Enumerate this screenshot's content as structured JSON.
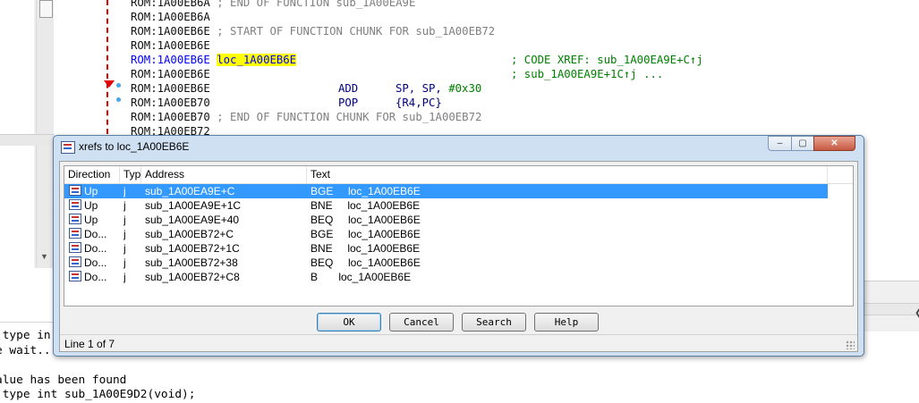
{
  "disassembly": {
    "lines": [
      {
        "addr": "ROM:1A00EB6A",
        "text": " ; END OF FUNCTION sub_1A00EA9E",
        "kind": "comment"
      },
      {
        "addr": "ROM:1A00EB6A",
        "text": "",
        "kind": "plain"
      },
      {
        "addr": "ROM:1A00EB6E",
        "text": " ; START OF FUNCTION CHUNK FOR sub_1A00EB72",
        "kind": "comment"
      },
      {
        "addr": "ROM:1A00EB6E",
        "text": "",
        "kind": "plain"
      },
      {
        "addr": "ROM:1A00EB6E",
        "label": "loc_1A00EB6E",
        "xref": "; CODE XREF: sub_1A00EA9E+C↑j",
        "kind": "label"
      },
      {
        "addr": "ROM:1A00EB6E",
        "xref": "; sub_1A00EA9E+1C↑j ...",
        "kind": "xref"
      },
      {
        "addr": "ROM:1A00EB6E",
        "mnem": "ADD",
        "ops": "SP, SP, ",
        "imm": "#0x30",
        "kind": "insn"
      },
      {
        "addr": "ROM:1A00EB70",
        "mnem": "POP",
        "ops": "{R4,PC}",
        "kind": "insn"
      },
      {
        "addr": "ROM:1A00EB70",
        "text": " ; END OF FUNCTION CHUNK FOR sub_1A00EB72",
        "kind": "comment"
      },
      {
        "addr": "ROM:1A00EB72",
        "text": "",
        "kind": "plain"
      }
    ]
  },
  "output": {
    "lines": [
      " type in",
      "e wait..",
      "",
      "alue has been found",
      " type int sub_1A00E9D2(void);"
    ]
  },
  "dialog": {
    "title": "xrefs to loc_1A00EB6E",
    "caption_buttons": {
      "minimize": "–",
      "maximize": "▢",
      "close": "✕"
    },
    "columns": [
      "Direction",
      "Typ",
      "Address",
      "Text"
    ],
    "rows": [
      {
        "direction": "Up",
        "type": "j",
        "address": "sub_1A00EA9E+C",
        "text": "BGE     loc_1A00EB6E",
        "selected": true
      },
      {
        "direction": "Up",
        "type": "j",
        "address": "sub_1A00EA9E+1C",
        "text": "BNE     loc_1A00EB6E",
        "selected": false
      },
      {
        "direction": "Up",
        "type": "j",
        "address": "sub_1A00EA9E+40",
        "text": "BEQ     loc_1A00EB6E",
        "selected": false
      },
      {
        "direction": "Do...",
        "type": "j",
        "address": "sub_1A00EB72+C",
        "text": "BGE     loc_1A00EB6E",
        "selected": false
      },
      {
        "direction": "Do...",
        "type": "j",
        "address": "sub_1A00EB72+1C",
        "text": "BNE     loc_1A00EB6E",
        "selected": false
      },
      {
        "direction": "Do...",
        "type": "j",
        "address": "sub_1A00EB72+38",
        "text": "BEQ     loc_1A00EB6E",
        "selected": false
      },
      {
        "direction": "Do...",
        "type": "j",
        "address": "sub_1A00EB72+C8",
        "text": "B       loc_1A00EB6E",
        "selected": false
      }
    ],
    "buttons": {
      "ok": "OK",
      "cancel": "Cancel",
      "search": "Search",
      "help": "Help"
    },
    "status": "Line 1 of 7"
  },
  "colors": {
    "selection": "#3399ff",
    "label_highlight": "#ffff00",
    "xref_green": "#008000",
    "instruction_navy": "#000080",
    "flow_red": "#e00000"
  }
}
